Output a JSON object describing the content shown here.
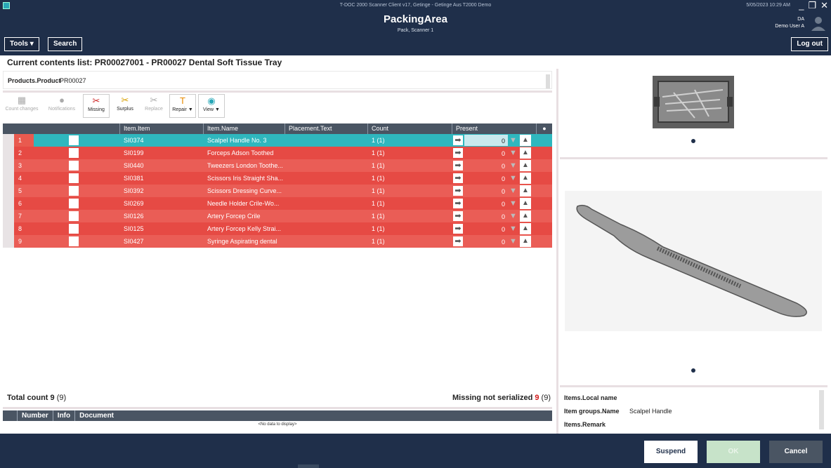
{
  "window": {
    "title": "T-DOC 2000 Scanner Client v17, Getinge - Getinge Aus T2000 Demo",
    "datetime": "5/05/2023 10:29 AM"
  },
  "header": {
    "title": "PackingArea",
    "subtitle": "Pack, Scanner 1",
    "user_initials": "DA",
    "user_name": "Demo User A",
    "tools_label": "Tools ▾",
    "search_label": "Search",
    "logout_label": "Log out"
  },
  "main": {
    "title": "Current contents list: PR00027001 - PR00027 Dental Soft Tissue Tray",
    "product_label": "Products.Product",
    "product_value": "PR00027"
  },
  "toolbar": {
    "count_changes": "Count changes",
    "notifications": "Notifications",
    "missing": "Missing",
    "surplus": "Surplus",
    "replace": "Replace",
    "repair": "Repair ▼",
    "view": "View ▼"
  },
  "grid": {
    "columns": [
      "Item.Item",
      "Item.Name",
      "Placement.Text",
      "Count",
      "Present"
    ],
    "rows": [
      {
        "num": "1",
        "item": "SI0374",
        "name": "Scalpel Handle No. 3",
        "count": "1 (1)",
        "present": "0"
      },
      {
        "num": "2",
        "item": "SI0199",
        "name": "Forceps Adson Toothed",
        "count": "1 (1)",
        "present": "0"
      },
      {
        "num": "3",
        "item": "SI0440",
        "name": "Tweezers London Toothe...",
        "count": "1 (1)",
        "present": "0"
      },
      {
        "num": "4",
        "item": "SI0381",
        "name": "Scissors Iris Straight Sha...",
        "count": "1 (1)",
        "present": "0"
      },
      {
        "num": "5",
        "item": "SI0392",
        "name": "Scissors Dressing Curve...",
        "count": "1 (1)",
        "present": "0"
      },
      {
        "num": "6",
        "item": "SI0269",
        "name": "Needle Holder Crile-Wo...",
        "count": "1 (1)",
        "present": "0"
      },
      {
        "num": "7",
        "item": "SI0126",
        "name": "Artery Forcep Crile",
        "count": "1 (1)",
        "present": "0"
      },
      {
        "num": "8",
        "item": "SI0125",
        "name": "Artery Forcep Kelly Strai...",
        "count": "1 (1)",
        "present": "0"
      },
      {
        "num": "9",
        "item": "SI0427",
        "name": "Syringe Aspirating dental",
        "count": "1 (1)",
        "present": "0"
      }
    ]
  },
  "totals": {
    "total_label": "Total count",
    "total_value": "9",
    "total_paren": "(9)",
    "missing_label": "Missing not serialized",
    "missing_value": "9",
    "missing_paren": "(9)"
  },
  "documents": {
    "columns": [
      "Number",
      "Info",
      "Document"
    ],
    "empty_text": "<No data to display>"
  },
  "info_panel": {
    "local_name_label": "Items.Local name",
    "group_label": "Item groups.Name",
    "group_value": "Scalpel Handle",
    "remark_label": "Items.Remark"
  },
  "footer": {
    "suspend_label": "Suspend",
    "ok_label": "OK",
    "cancel_label": "Cancel"
  },
  "colors": {
    "header_bg": "#1f2f4a",
    "selected_row": "#2fb7be",
    "missing_row": "#e64a44",
    "grid_header": "#4a5563"
  }
}
